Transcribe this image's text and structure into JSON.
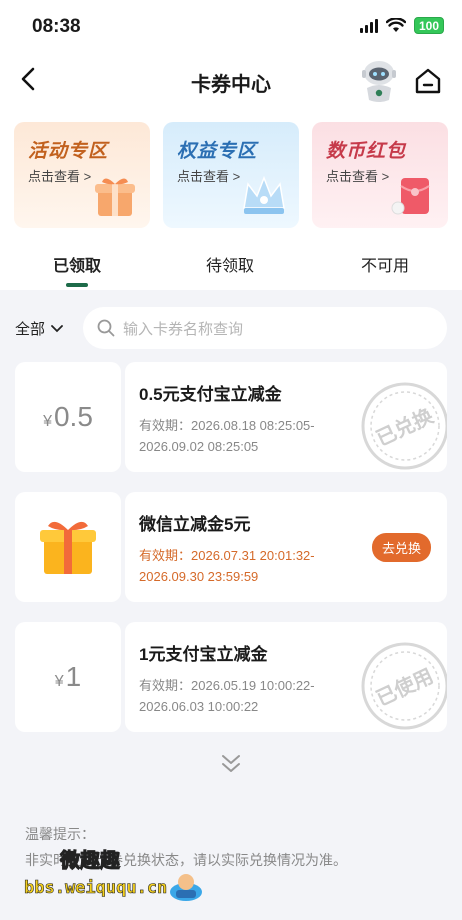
{
  "status": {
    "time": "08:38",
    "battery": "100"
  },
  "nav": {
    "title": "卡券中心"
  },
  "promos": [
    {
      "title": "活动专区",
      "sub": "点击查看 >"
    },
    {
      "title": "权益专区",
      "sub": "点击查看 >"
    },
    {
      "title": "数币红包",
      "sub": "点击查看 >"
    }
  ],
  "tabs": [
    {
      "label": "已领取",
      "active": true
    },
    {
      "label": "待领取",
      "active": false
    },
    {
      "label": "不可用",
      "active": false
    }
  ],
  "filter": {
    "label": "全部"
  },
  "search": {
    "placeholder": "输入卡券名称查询"
  },
  "coupons": [
    {
      "currency": "¥",
      "amount": "0.5",
      "name": "0.5元支付宝立减金",
      "valid_line1": "有效期：2026.08.18 08:25:05-",
      "valid_line2": "2026.09.02 08:25:05",
      "stamp": "已兑换"
    },
    {
      "name": "微信立减金5元",
      "valid_line1": "有效期：2026.07.31 20:01:32-",
      "valid_line2": "2026.09.30 23:59:59",
      "button": "去兑换"
    },
    {
      "currency": "¥",
      "amount": "1",
      "name": "1元支付宝立减金",
      "valid_line1": "有效期：2026.05.19 10:00:22-",
      "valid_line2": "2026.06.03 10:00:22",
      "stamp": "已使用"
    }
  ],
  "tips": {
    "title": "温馨提示：",
    "text": "非实时更新卡券兑换状态，请以实际兑换情况为准。"
  },
  "watermark": {
    "top": "微趣趣",
    "url": "bbs.weiququ.cn"
  },
  "colors": {
    "accent": "#1d6b49",
    "redeem": "#e26a2c",
    "page_bg": "#f3f4f8"
  }
}
